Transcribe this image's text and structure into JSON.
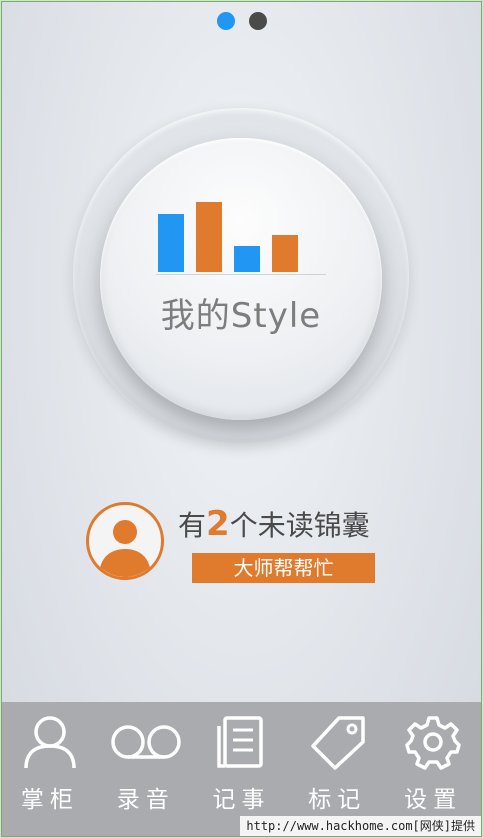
{
  "pager": {
    "total": 2,
    "active_index": 0
  },
  "colors": {
    "accent_blue": "#2196f3",
    "accent_orange": "#e07a2c",
    "tabbar_bg": "#a9abae"
  },
  "knob": {
    "label": "我的Style",
    "icon": "bar-chart-icon",
    "bars": [
      {
        "value": 0.72,
        "color": "#2196f3"
      },
      {
        "value": 0.88,
        "color": "#e07a2c"
      },
      {
        "value": 0.32,
        "color": "#2196f3"
      },
      {
        "value": 0.46,
        "color": "#e07a2c"
      }
    ]
  },
  "notice": {
    "prefix": "有",
    "count": "2",
    "suffix": "个未读锦囊",
    "button_label": "大师帮帮忙",
    "avatar_icon": "user-avatar-icon"
  },
  "tabs": [
    {
      "label": "掌柜",
      "icon": "person-icon"
    },
    {
      "label": "录音",
      "icon": "tape-icon"
    },
    {
      "label": "记事",
      "icon": "notes-icon"
    },
    {
      "label": "标记",
      "icon": "tag-icon"
    },
    {
      "label": "设置",
      "icon": "gear-icon"
    }
  ],
  "footer_url": "http://www.hackhome.com[网侠]提供"
}
